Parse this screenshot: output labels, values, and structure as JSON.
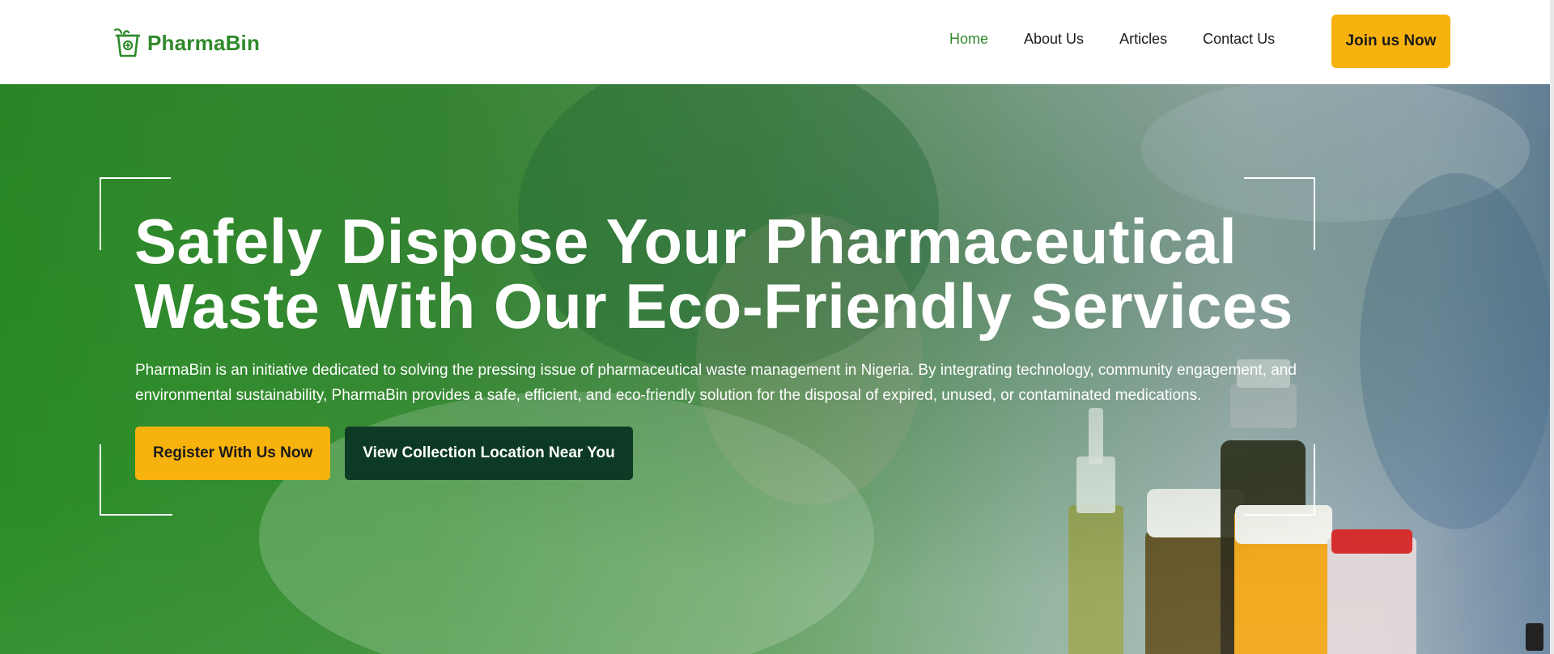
{
  "brand": {
    "name": "PharmaBin",
    "color": "#2f8a2a"
  },
  "nav": {
    "items": [
      {
        "label": "Home",
        "active": true
      },
      {
        "label": "About Us",
        "active": false
      },
      {
        "label": "Articles",
        "active": false
      },
      {
        "label": "Contact Us",
        "active": false
      }
    ],
    "cta_label": "Join us Now"
  },
  "hero": {
    "title_line1": "Safely Dispose Your Pharmaceutical",
    "title_line2": "Waste With Our Eco-Friendly Services",
    "description": "PharmaBin is an initiative dedicated to solving the pressing issue of pharmaceutical waste management in Nigeria. By integrating technology, community engagement, and environmental sustainability, PharmaBin provides a safe, efficient, and eco-friendly solution for the disposal of expired, unused, or contaminated medications.",
    "primary_button": "Register With Us Now",
    "secondary_button": "View Collection Location Near You"
  },
  "colors": {
    "accent": "#f8b20d",
    "dark": "#0d3a24",
    "hero_green": "#2a8c27"
  },
  "icons": [
    "recycle-bin-logo-icon"
  ]
}
